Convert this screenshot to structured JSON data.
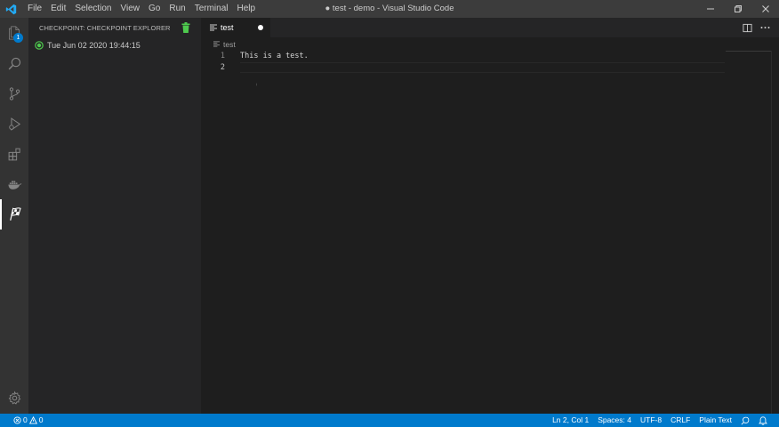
{
  "window": {
    "title": "● test - demo - Visual Studio Code",
    "menu": [
      "File",
      "Edit",
      "Selection",
      "View",
      "Go",
      "Run",
      "Terminal",
      "Help"
    ]
  },
  "activity_bar": {
    "items": [
      {
        "name": "explorer",
        "icon": "files-icon",
        "badge": "1"
      },
      {
        "name": "search",
        "icon": "search-icon"
      },
      {
        "name": "source-control",
        "icon": "source-control-icon"
      },
      {
        "name": "run",
        "icon": "run-debug-icon"
      },
      {
        "name": "extensions",
        "icon": "extensions-icon"
      },
      {
        "name": "docker",
        "icon": "docker-icon"
      },
      {
        "name": "checkpoints",
        "icon": "checkered-flag-icon",
        "active": true
      }
    ],
    "bottom": {
      "icon": "gear-icon"
    }
  },
  "sidebar": {
    "title": "CHECKPOINT: CHECKPOINT EXPLORER",
    "checkpoints": [
      {
        "label": "Tue Jun 02 2020 19:44:15",
        "icon": "check-circle-icon"
      }
    ]
  },
  "editor": {
    "tab": {
      "label": "test",
      "dirty": true
    },
    "breadcrumb": "test",
    "lines": [
      {
        "number": "1",
        "text": "This is a test."
      },
      {
        "number": "2",
        "text": ""
      }
    ],
    "current_line": 2
  },
  "status_bar": {
    "errors": "0",
    "warnings": "0",
    "position": "Ln 2, Col 1",
    "indentation": "Spaces: 4",
    "encoding": "UTF-8",
    "line_ending": "CRLF",
    "language": "Plain Text"
  },
  "colors": {
    "accent": "#007acc",
    "titlebar": "#3c3c3c",
    "activitybar": "#333333",
    "sidebar": "#252526",
    "editor": "#1e1e1e",
    "checkpoint": "#4ec94e"
  }
}
